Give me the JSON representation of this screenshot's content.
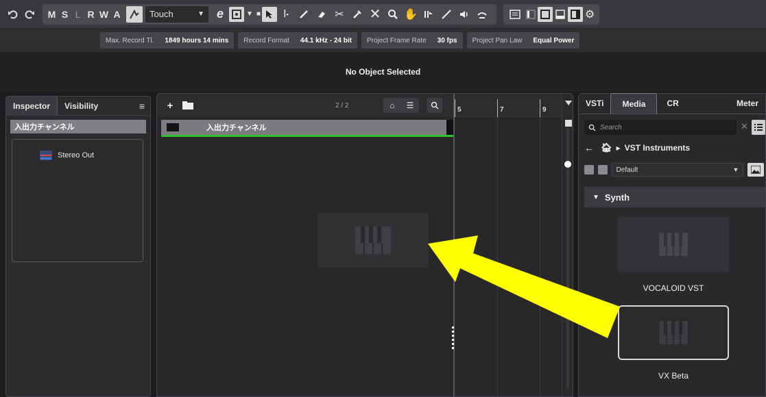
{
  "toolbar": {
    "undo_icon": "undo-icon",
    "redo_icon": "redo-icon",
    "letters": [
      "M",
      "S",
      "L",
      "R",
      "W",
      "A"
    ],
    "automation_mode": "Touch",
    "tools": [
      "object-select-icon",
      "range-select-icon",
      "draw-pencil-icon",
      "erase-icon",
      "split-scissors-icon",
      "glue-icon",
      "mute-x-icon",
      "zoom-icon",
      "hand-icon",
      "comp-icon",
      "line-icon",
      "play-speaker-icon",
      "color-icon"
    ]
  },
  "info": {
    "max_record_label": "Max. Record Tl.",
    "max_record_value": "1849 hours 14 mins",
    "record_format_label": "Record Format",
    "record_format_value": "44.1 kHz - 24 bit",
    "frame_rate_label": "Project Frame Rate",
    "frame_rate_value": "30 fps",
    "pan_law_label": "Project Pan Law",
    "pan_law_value": "Equal Power"
  },
  "status": {
    "text": "No Object Selected"
  },
  "inspector": {
    "tab_inspector": "Inspector",
    "tab_visibility": "Visibility",
    "menu_glyph": "≡",
    "track_name": "入出力チャンネル",
    "output_name": "Stereo Out"
  },
  "project": {
    "track_count": "2 / 2",
    "track_name": "入出力チャンネル",
    "ruler": [
      "5",
      "7",
      "9"
    ]
  },
  "rightzone": {
    "tabs": [
      "VSTi",
      "Media",
      "CR",
      "Meter"
    ],
    "active_tab": "Media",
    "search_placeholder": "Search",
    "breadcrumb": "VST Instruments",
    "preset": "Default",
    "section": "Synth",
    "items": [
      {
        "label": "VOCALOID VST",
        "selected": false
      },
      {
        "label": "VX Beta",
        "selected": true
      }
    ]
  },
  "annotation": {
    "color": "#ffff00"
  }
}
